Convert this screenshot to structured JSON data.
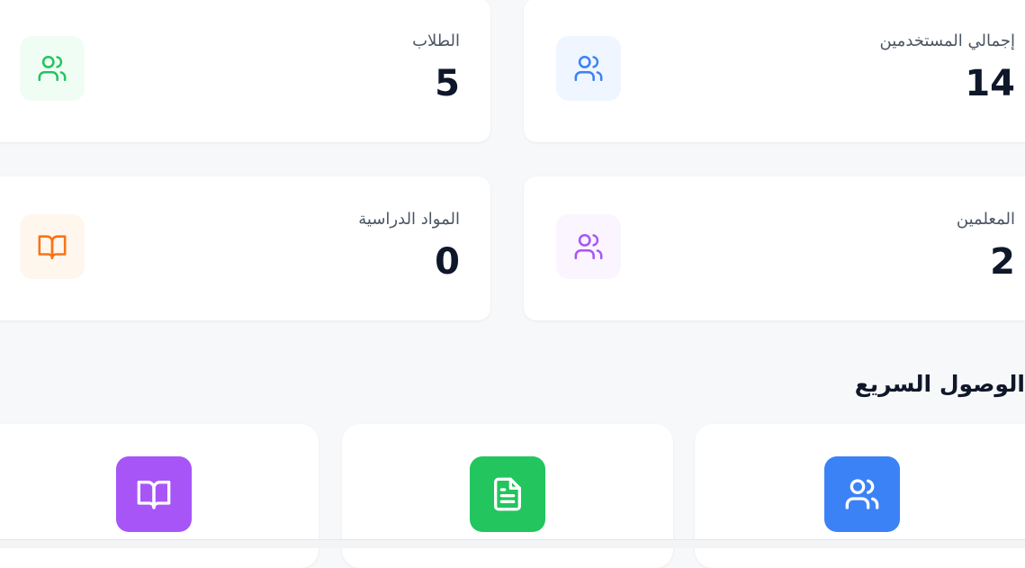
{
  "colors": {
    "background": "#f7f8fa",
    "card": "#ffffff",
    "text_dark": "#0f172a",
    "text_muted": "#4b5563",
    "blue": "#3b82f6",
    "green": "#22c55e",
    "purple": "#a855f7",
    "orange": "#f97316"
  },
  "stats": {
    "total_users": {
      "label": "إجمالي المستخدمين",
      "value": "14",
      "icon": "users-icon"
    },
    "students": {
      "label": "الطلاب",
      "value": "5",
      "icon": "users-icon"
    },
    "teachers": {
      "label": "المعلمين",
      "value": "2",
      "icon": "users-icon"
    },
    "subjects": {
      "label": "المواد الدراسية",
      "value": "0",
      "icon": "book-open-icon"
    }
  },
  "quick_access": {
    "title": "الوصول السريع",
    "items": [
      {
        "icon": "users-icon"
      },
      {
        "icon": "file-text-icon"
      },
      {
        "icon": "book-open-icon"
      }
    ]
  }
}
